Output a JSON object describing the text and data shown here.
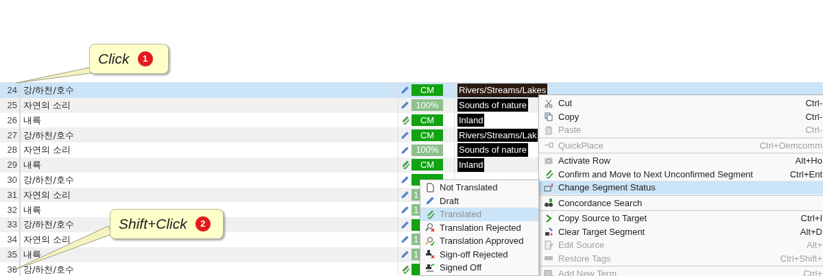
{
  "callouts": [
    {
      "text": "Click",
      "number": "1"
    },
    {
      "text": "Shift+Click",
      "number": "2"
    }
  ],
  "rows": [
    {
      "number": "24",
      "source": "강/하천/호수",
      "kind": "draft",
      "match": {
        "kind": "cm",
        "text": "CM"
      },
      "target": "Rivers/Streams/Lakes",
      "selected": true
    },
    {
      "number": "25",
      "source": "자연의 소리",
      "kind": "draft",
      "match": {
        "kind": "fuzzy",
        "text": "100%"
      },
      "target": "Sounds of nature",
      "selected": false
    },
    {
      "number": "26",
      "source": "내륙",
      "kind": "translated",
      "match": {
        "kind": "cm",
        "text": "CM"
      },
      "target": "Inland",
      "selected": false
    },
    {
      "number": "27",
      "source": "강/하천/호수",
      "kind": "draft",
      "match": {
        "kind": "cm",
        "text": "CM"
      },
      "target": "Rivers/Streams/Lak",
      "selected": false
    },
    {
      "number": "28",
      "source": "자연의 소리",
      "kind": "draft",
      "match": {
        "kind": "fuzzy",
        "text": "100%"
      },
      "target": "Sounds of nature",
      "selected": false
    },
    {
      "number": "29",
      "source": "내륙",
      "kind": "translated",
      "match": {
        "kind": "cm",
        "text": "CM"
      },
      "target": "Inland",
      "selected": false
    },
    {
      "number": "30",
      "source": "강/하천/호수",
      "kind": "draft",
      "match": {
        "kind": "cm"
      },
      "selected": false
    },
    {
      "number": "31",
      "source": "자연의 소리",
      "kind": "draft",
      "match": {
        "kind": "fuzzy",
        "text": "1",
        "covered": true
      },
      "selected": false
    },
    {
      "number": "32",
      "source": "내륙",
      "kind": "draft",
      "match": {
        "kind": "fuzzy",
        "text": "1",
        "covered": true
      },
      "selected": false
    },
    {
      "number": "33",
      "source": "강/하천/호수",
      "kind": "draft",
      "match": {
        "kind": "cm",
        "covered": true
      },
      "selected": false
    },
    {
      "number": "34",
      "source": "자연의 소리",
      "kind": "draft",
      "match": {
        "kind": "fuzzy",
        "text": "1",
        "covered": true
      },
      "selected": false
    },
    {
      "number": "35",
      "source": "내륙",
      "kind": "draft",
      "match": {
        "kind": "fuzzy",
        "text": "1",
        "covered": true
      },
      "selected": false
    },
    {
      "number": "36",
      "source": "강/하천/호수",
      "kind": "translated",
      "match": {
        "kind": "cm",
        "covered": true
      },
      "selected": false
    }
  ],
  "context_menu": [
    {
      "label": "Cut",
      "shortcut": "Ctrl-",
      "disabled": false,
      "selected": false,
      "separator_after": false
    },
    {
      "label": "Copy",
      "shortcut": "Ctrl-",
      "disabled": false,
      "selected": false,
      "separator_after": false
    },
    {
      "label": "Paste",
      "shortcut": "Ctrl-",
      "disabled": true,
      "selected": false,
      "separator_after": true
    },
    {
      "label": "QuickPlace",
      "shortcut": "Ctrl+Oemcomm",
      "disabled": true,
      "selected": false,
      "separator_after": true
    },
    {
      "label": "Activate Row",
      "shortcut": "Alt+Ho",
      "disabled": false,
      "selected": false,
      "separator_after": false
    },
    {
      "label": "Confirm and Move to Next Unconfirmed Segment",
      "shortcut": "Ctrl+Ent",
      "disabled": false,
      "selected": false,
      "separator_after": false
    },
    {
      "label": "Change Segment Status",
      "disabled": false,
      "selected": true,
      "separator_after": true
    },
    {
      "label": "Concordance Search",
      "disabled": false,
      "selected": false,
      "separator_after": true
    },
    {
      "label": "Copy Source to Target",
      "shortcut": "Ctrl+I",
      "disabled": false,
      "selected": false,
      "separator_after": false
    },
    {
      "label": "Clear Target Segment",
      "shortcut": "Alt+D",
      "disabled": false,
      "selected": false,
      "separator_after": false
    },
    {
      "label": "Edit Source",
      "shortcut": "Alt+",
      "disabled": true,
      "selected": false,
      "separator_after": false
    },
    {
      "label": "Restore Tags",
      "shortcut": "Ctrl+Shift+",
      "disabled": true,
      "selected": false,
      "separator_after": true
    },
    {
      "label": "Add New Term",
      "shortcut": "Ctrl+",
      "disabled": true,
      "selected": false,
      "separator_after": false
    }
  ],
  "status_submenu": [
    {
      "label": "Not Translated",
      "selected": false,
      "disabled": false
    },
    {
      "label": "Draft",
      "selected": false,
      "disabled": false
    },
    {
      "label": "Translated",
      "selected": true,
      "disabled": true
    },
    {
      "label": "Translation Rejected",
      "selected": false,
      "disabled": false
    },
    {
      "label": "Translation Approved",
      "selected": false,
      "disabled": false
    },
    {
      "label": "Sign-off Rejected",
      "selected": false,
      "disabled": false
    },
    {
      "label": "Signed Off",
      "selected": false,
      "disabled": false
    }
  ]
}
